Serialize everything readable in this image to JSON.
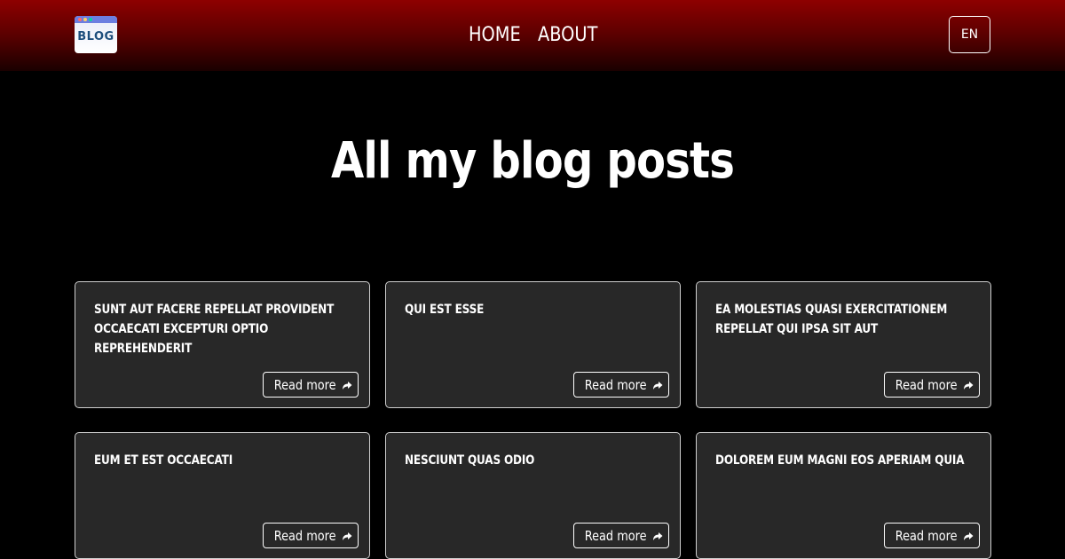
{
  "header": {
    "logo_text": "BLOG",
    "nav": [
      {
        "label": "HOME"
      },
      {
        "label": "ABOUT"
      }
    ],
    "language": "EN"
  },
  "main": {
    "title": "All my blog posts",
    "read_more_label": "Read more",
    "posts": [
      {
        "title": "sunt aut facere repellat provident occaecati excepturi optio reprehenderit"
      },
      {
        "title": "qui est esse"
      },
      {
        "title": "ea molestias quasi exercitationem repellat qui ipsa sit aut"
      },
      {
        "title": "eum et est occaecati"
      },
      {
        "title": "nesciunt quas odio"
      },
      {
        "title": "dolorem eum magni eos aperiam quia"
      }
    ]
  },
  "colors": {
    "header_top": "#8e0000",
    "header_bottom": "#1a0000",
    "page_background": "#000000",
    "card_background": "#282828",
    "text": "#ffffff"
  }
}
